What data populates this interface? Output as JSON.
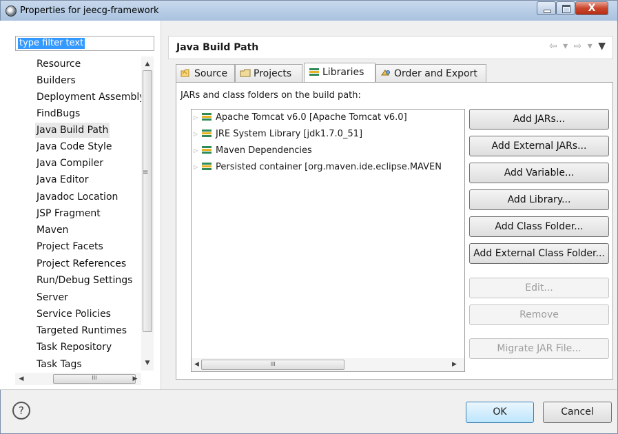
{
  "window": {
    "title": "Properties for jeecg-framework",
    "controls": {
      "minimize_icon": "minimize-icon",
      "maximize_icon": "maximize-icon",
      "close_glyph": "X"
    }
  },
  "filter": {
    "value": "type filter text"
  },
  "tree": {
    "items": [
      {
        "label": "Resource"
      },
      {
        "label": "Builders"
      },
      {
        "label": "Deployment Assembly"
      },
      {
        "label": "FindBugs"
      },
      {
        "label": "Java Build Path",
        "selected": true
      },
      {
        "label": "Java Code Style"
      },
      {
        "label": "Java Compiler"
      },
      {
        "label": "Java Editor"
      },
      {
        "label": "Javadoc Location"
      },
      {
        "label": "JSP Fragment"
      },
      {
        "label": "Maven"
      },
      {
        "label": "Project Facets"
      },
      {
        "label": "Project References"
      },
      {
        "label": "Run/Debug Settings"
      },
      {
        "label": "Server"
      },
      {
        "label": "Service Policies"
      },
      {
        "label": "Targeted Runtimes"
      },
      {
        "label": "Task Repository"
      },
      {
        "label": "Task Tags"
      }
    ],
    "scroll_grip": "≡",
    "hscroll_grip": "III"
  },
  "page": {
    "title": "Java Build Path"
  },
  "tabs": [
    {
      "label": "Source",
      "icon": "source-folder-icon"
    },
    {
      "label": "Projects",
      "icon": "projects-icon"
    },
    {
      "label": "Libraries",
      "icon": "libraries-icon",
      "active": true
    },
    {
      "label": "Order and Export",
      "icon": "order-export-icon"
    }
  ],
  "libraries": {
    "caption": "JARs and class folders on the build path:",
    "entries": [
      {
        "label": "Apache Tomcat v6.0 [Apache Tomcat v6.0]"
      },
      {
        "label": "JRE System Library [jdk1.7.0_51]"
      },
      {
        "label": "Maven Dependencies"
      },
      {
        "label": "Persisted container [org.maven.ide.eclipse.MAVEN"
      }
    ],
    "hscroll_grip": "III"
  },
  "buttons": {
    "add_jars": "Add JARs...",
    "add_external_jars": "Add External JARs...",
    "add_variable": "Add Variable...",
    "add_library": "Add Library...",
    "add_class_folder": "Add Class Folder...",
    "add_external_class_folder": "Add External Class Folder...",
    "edit": "Edit...",
    "remove": "Remove",
    "migrate_jar": "Migrate JAR File...",
    "ok": "OK",
    "cancel": "Cancel",
    "help": "?"
  },
  "colors": {
    "selection": "#3399ff",
    "ok_border": "#3c7fb1",
    "close_button": "#c9462c",
    "library_icon_green": "#2e8b57",
    "library_icon_yellow": "#e6b422"
  }
}
